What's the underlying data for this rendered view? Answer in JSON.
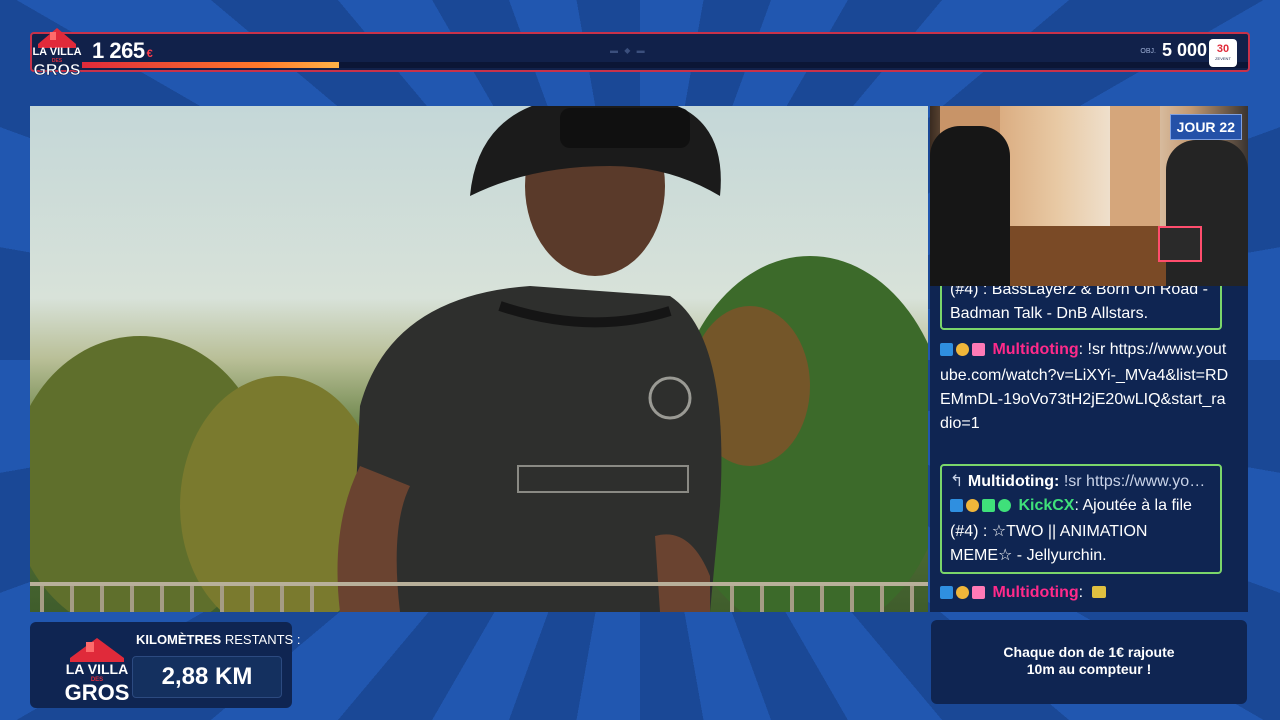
{
  "topbar": {
    "logo": {
      "line1": "LA VILLA",
      "line2": "DES",
      "line3": "GROS"
    },
    "raised": "1 265",
    "raised_currency": "€",
    "progress_fraction": 0.22,
    "goal_prefix": "OBJ.",
    "goal": "5 000",
    "goal_currency": "€",
    "badge": {
      "number": "30",
      "sub": "ZEVENT"
    }
  },
  "webcam": {
    "day_badge": "JOUR 22"
  },
  "chat": {
    "messages": [
      {
        "partial_text": "(#4) : BassLayer2 & Born On Road - Badman Talk - DnB Allstars."
      },
      {
        "user": "Multidoting",
        "sep": ":",
        "text": "!sr https://www.youtube.com/watch?v=LiXYi-_MVa4&list=RDEMmDL-19oVo73tH2jE20wLIQ&start_radio=1"
      },
      {
        "reply_user": "Multidoting:",
        "reply_text": "!sr https://www.yo…",
        "user": "KickCX",
        "sep": ":",
        "text": "Ajoutée à la file (#4) : ☆TWO || ANIMATION MEME☆ - Jellyurchin."
      },
      {
        "user": "Multidoting",
        "sep": ":",
        "text": ""
      }
    ],
    "colors": {
      "highlight_border": "#7bd66a",
      "pink_user": "#ff2a8a",
      "green_user": "#3fe07a"
    }
  },
  "km_panel": {
    "logo": {
      "line1": "LA VILLA",
      "line2": "DES",
      "line3": "GROS"
    },
    "label_bold": "KILOMÈTRES",
    "label_rest": " RESTANTS :",
    "value": "2,88 KM"
  },
  "info_panel": {
    "line1": "Chaque don de 1€ rajoute",
    "line2": "10m au compteur !"
  }
}
